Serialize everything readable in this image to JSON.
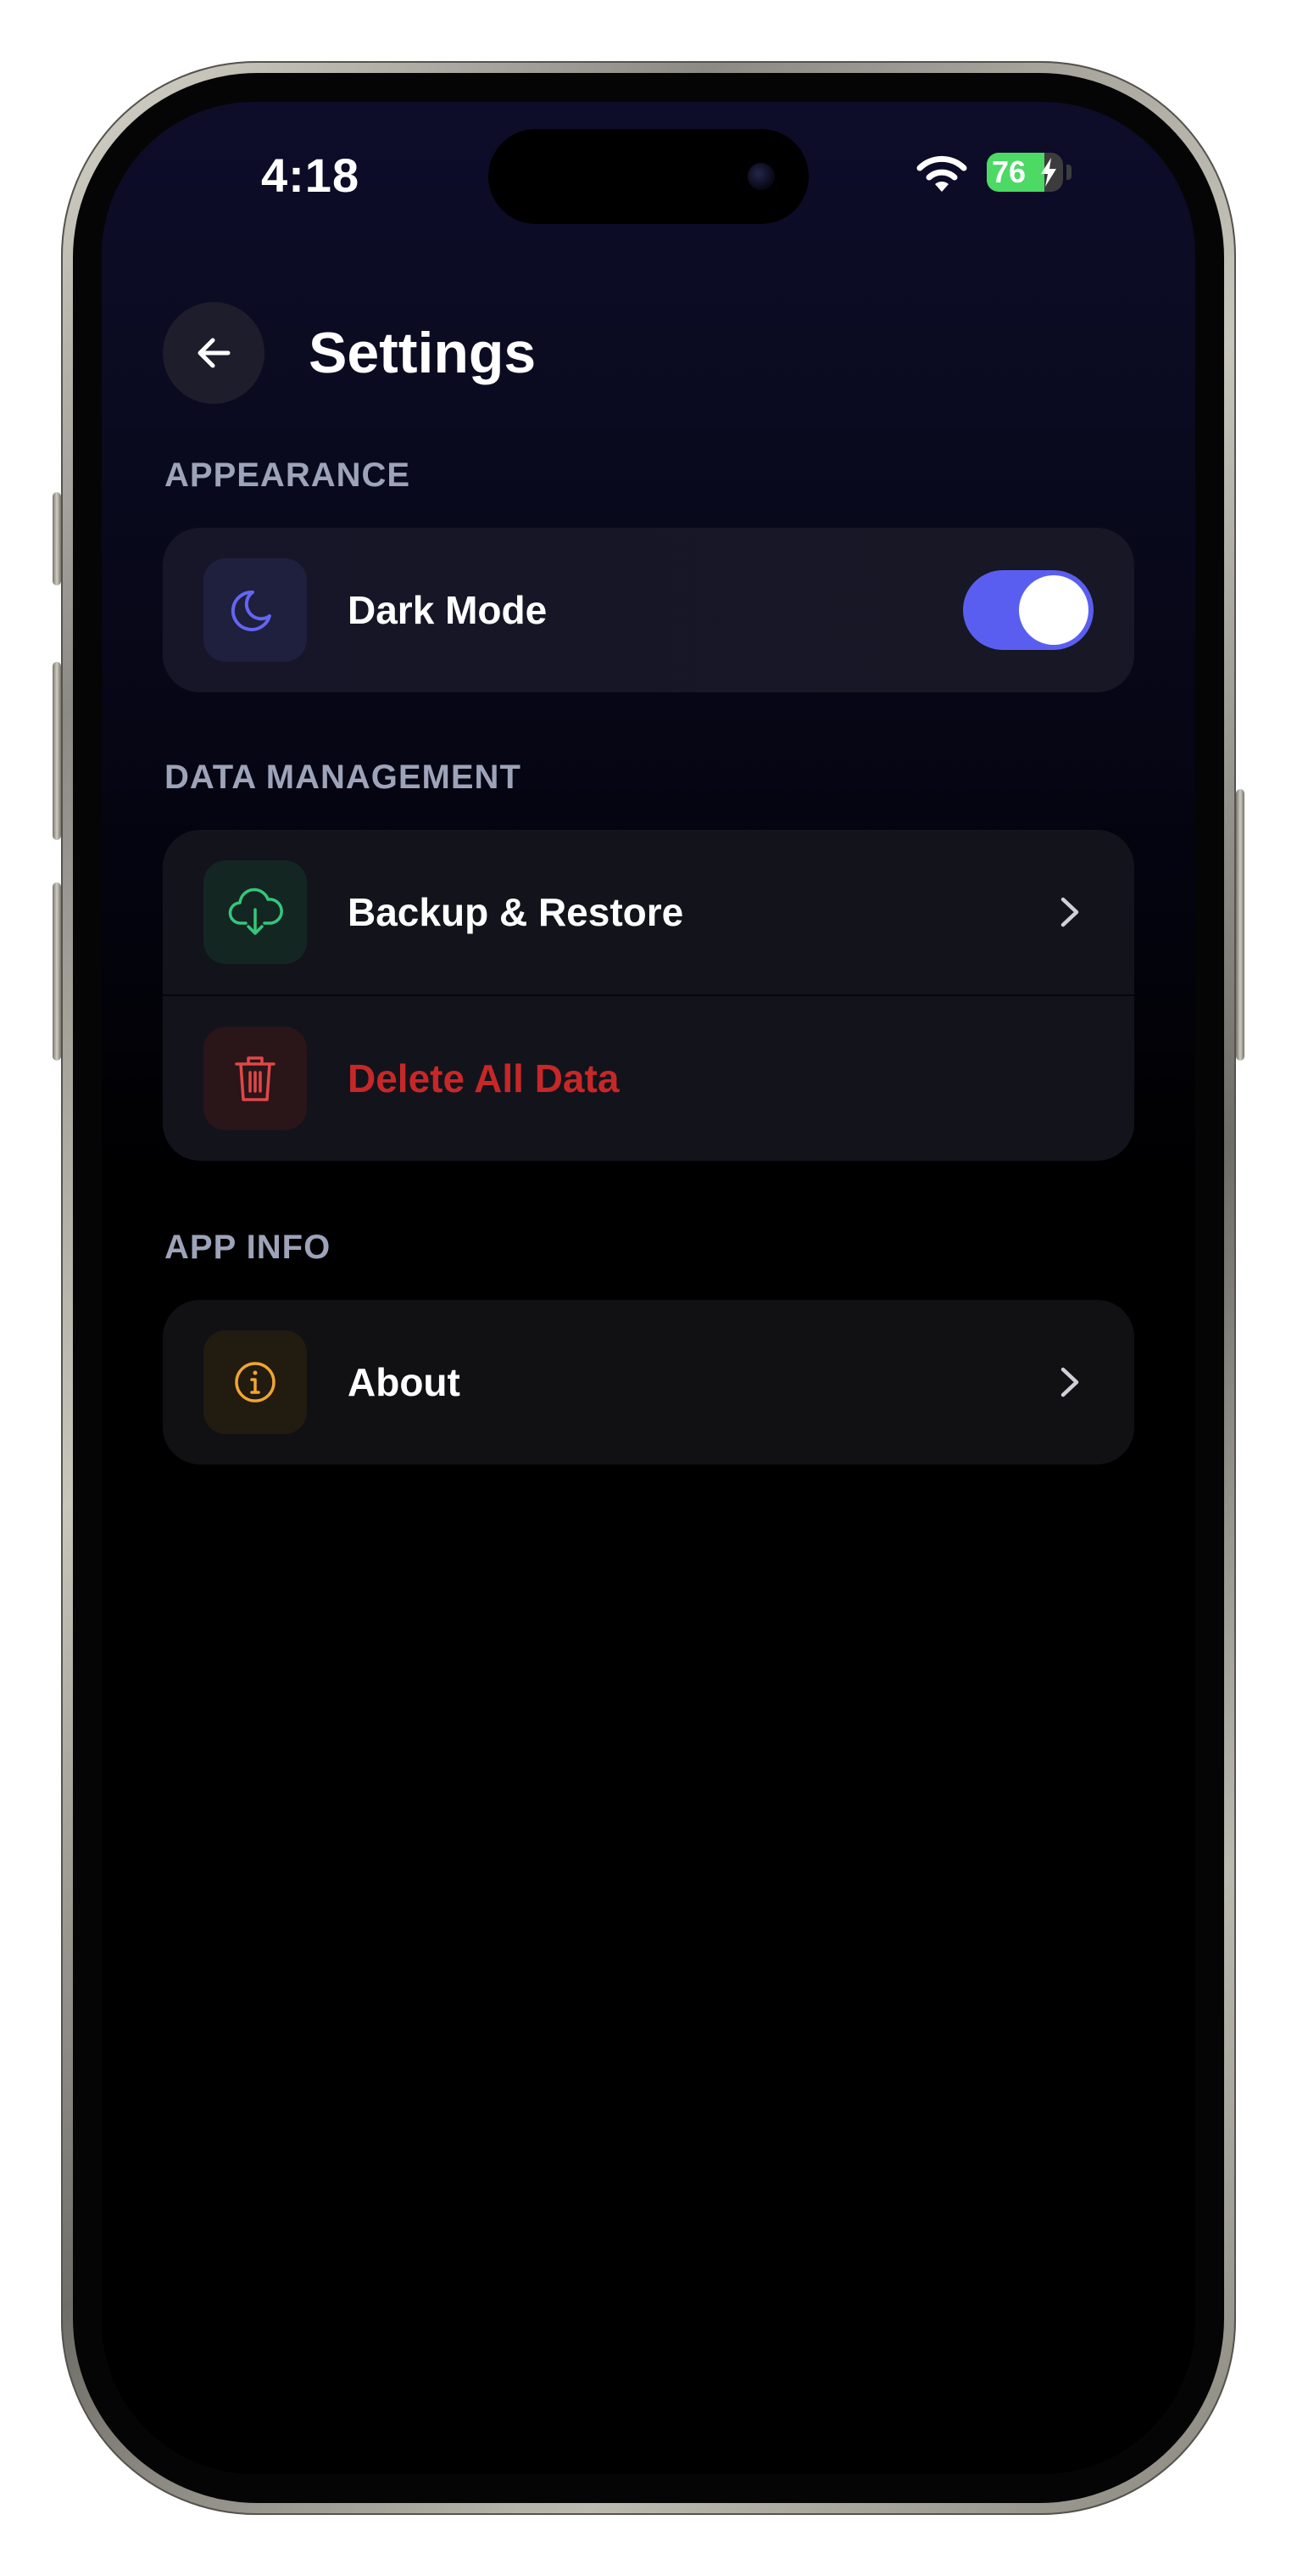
{
  "status_bar": {
    "time": "4:18",
    "battery_percent": "76",
    "battery_level": 0.76,
    "charging": true,
    "icons": [
      "wifi-icon",
      "battery-icon",
      "bolt-icon"
    ]
  },
  "header": {
    "title": "Settings",
    "back_icon": "arrow-left-icon"
  },
  "sections": {
    "appearance": {
      "label": "APPEARANCE",
      "dark_mode": {
        "label": "Dark Mode",
        "icon": "moon-icon",
        "enabled": true
      }
    },
    "data_management": {
      "label": "DATA MANAGEMENT",
      "backup": {
        "label": "Backup & Restore",
        "icon": "cloud-download-icon"
      },
      "delete": {
        "label": "Delete All Data",
        "icon": "trash-icon"
      }
    },
    "app_info": {
      "label": "APP INFO",
      "about": {
        "label": "About",
        "icon": "info-icon"
      }
    }
  },
  "colors": {
    "accent": "#5a5ef0",
    "danger": "#c62828",
    "success": "#34c77b",
    "warning": "#f0a534",
    "section_label": "#9da3b8",
    "card_background": "#14141f"
  }
}
